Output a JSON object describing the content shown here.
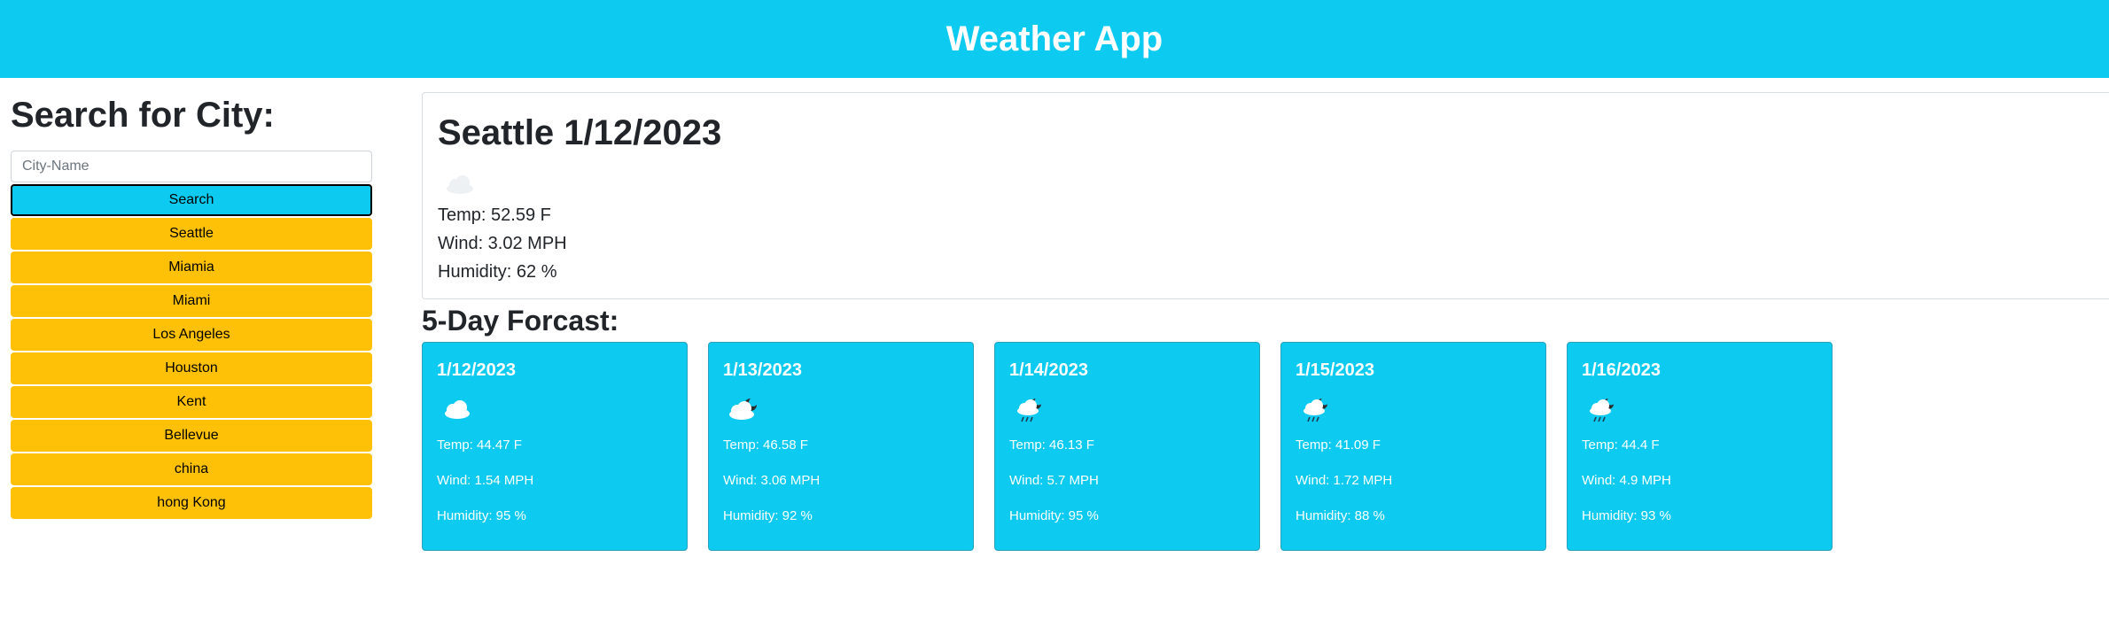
{
  "header": {
    "title": "Weather App"
  },
  "sidebar": {
    "heading": "Search for City:",
    "input_placeholder": "City-Name",
    "search_label": "Search",
    "history": [
      "Seattle",
      "Miamia",
      "Miami",
      "Los Angeles",
      "Houston",
      "Kent",
      "Bellevue",
      "china",
      "hong Kong"
    ]
  },
  "current": {
    "title": "Seattle 1/12/2023",
    "icon": "cloud-icon",
    "temp": "Temp: 52.59 F",
    "wind": "Wind: 3.02 MPH",
    "humidity": "Humidity: 62 %"
  },
  "forecast": {
    "heading": "5-Day Forcast:",
    "days": [
      {
        "date": "1/12/2023",
        "icon": "cloud-icon",
        "temp": "Temp: 44.47 F",
        "wind": "Wind: 1.54 MPH",
        "humidity": "Humidity: 95 %"
      },
      {
        "date": "1/13/2023",
        "icon": "cloud-moon-icon",
        "temp": "Temp: 46.58 F",
        "wind": "Wind: 3.06 MPH",
        "humidity": "Humidity: 92 %"
      },
      {
        "date": "1/14/2023",
        "icon": "rain-cloud-icon",
        "temp": "Temp: 46.13 F",
        "wind": "Wind: 5.7 MPH",
        "humidity": "Humidity: 95 %"
      },
      {
        "date": "1/15/2023",
        "icon": "rain-cloud-icon",
        "temp": "Temp: 41.09 F",
        "wind": "Wind: 1.72 MPH",
        "humidity": "Humidity: 88 %"
      },
      {
        "date": "1/16/2023",
        "icon": "rain-cloud-icon",
        "temp": "Temp: 44.4 F",
        "wind": "Wind: 4.9 MPH",
        "humidity": "Humidity: 93 %"
      }
    ]
  },
  "colors": {
    "header_bg": "#0dcaf0",
    "card_bg": "#0dcaf0",
    "city_button_bg": "#ffc107"
  }
}
